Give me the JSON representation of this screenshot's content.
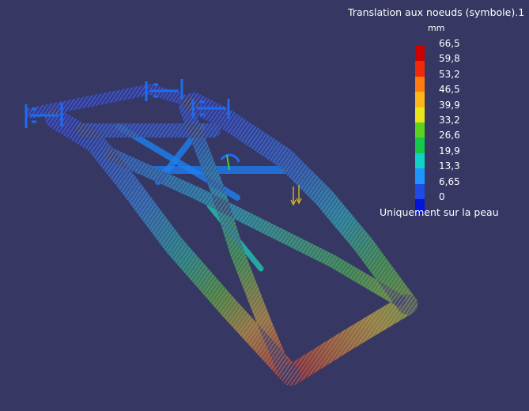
{
  "legend": {
    "title": "Translation aux noeuds (symbole).1",
    "unit": "mm",
    "values": [
      "66,5",
      "59,8",
      "53,2",
      "46,5",
      "39,9",
      "33,2",
      "26,6",
      "19,9",
      "13,3",
      "6,65",
      "0"
    ],
    "colors": [
      "#c80000",
      "#ee2a0a",
      "#ff7a10",
      "#ffb41a",
      "#e6e61a",
      "#5ad21e",
      "#14c84a",
      "#12d2c8",
      "#1e96ff",
      "#1e4be6",
      "#0014dc"
    ],
    "note": "Uniquement sur la peau"
  },
  "model": {
    "type": "deformed-frame-symbol-plot"
  }
}
